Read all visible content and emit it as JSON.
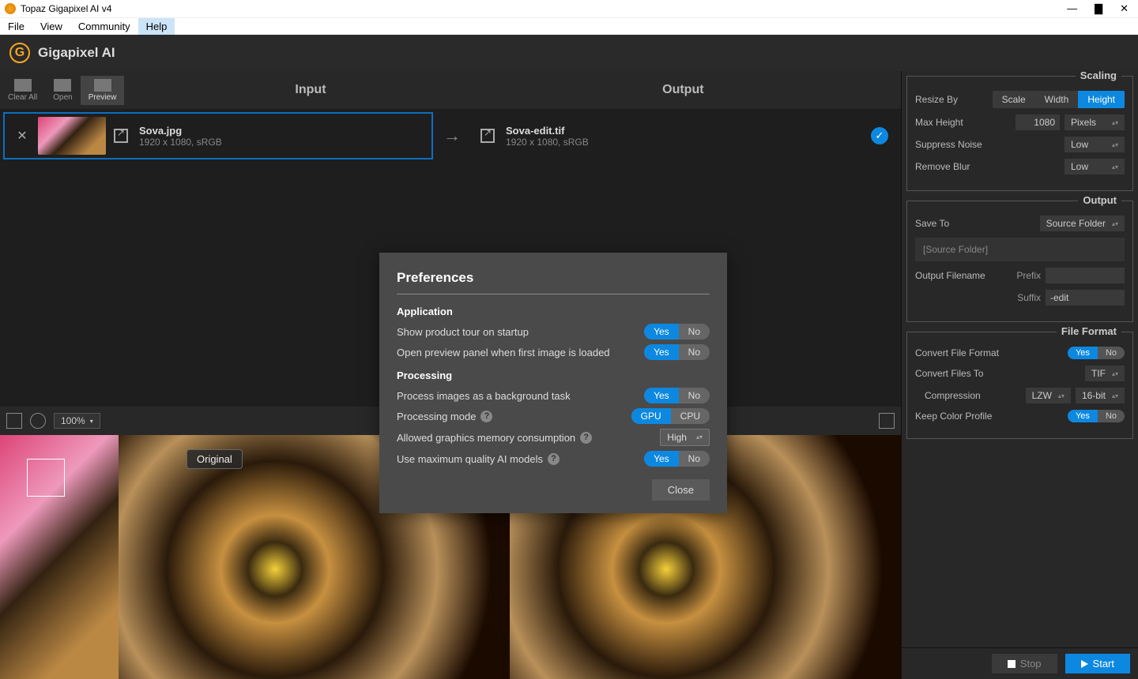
{
  "window": {
    "title": "Topaz Gigapixel AI v4"
  },
  "menu": {
    "file": "File",
    "view": "View",
    "community": "Community",
    "help": "Help"
  },
  "app": {
    "name": "Gigapixel AI",
    "logo_letter": "G"
  },
  "toolbar": {
    "clear_all": "Clear All",
    "open": "Open",
    "preview": "Preview",
    "input_header": "Input",
    "output_header": "Output"
  },
  "input_file": {
    "name": "Sova.jpg",
    "meta": "1920 x 1080, sRGB"
  },
  "output_file": {
    "name": "Sova-edit.tif",
    "meta": "1920 x 1080, sRGB"
  },
  "previewbar": {
    "zoom": "100%",
    "original_badge": "Original"
  },
  "modal": {
    "title": "Preferences",
    "section_app": "Application",
    "row_tour": "Show product tour on startup",
    "row_openprev": "Open preview panel when first image is loaded",
    "section_proc": "Processing",
    "row_bg": "Process images as a background task",
    "row_mode": "Processing mode",
    "row_mem": "Allowed graphics memory consumption",
    "row_maxq": "Use maximum quality AI models",
    "yes": "Yes",
    "no": "No",
    "gpu": "GPU",
    "cpu": "CPU",
    "mem_val": "High",
    "close": "Close"
  },
  "scaling": {
    "title": "Scaling",
    "resize_by": "Resize By",
    "scale": "Scale",
    "width": "Width",
    "height": "Height",
    "max_height": "Max Height",
    "max_height_val": "1080",
    "unit": "Pixels",
    "suppress": "Suppress Noise",
    "suppress_val": "Low",
    "blur": "Remove Blur",
    "blur_val": "Low"
  },
  "output": {
    "title": "Output",
    "save_to": "Save To",
    "save_to_val": "Source Folder",
    "path": "[Source Folder]",
    "filename": "Output Filename",
    "prefix": "Prefix",
    "prefix_val": "",
    "suffix": "Suffix",
    "suffix_val": "-edit"
  },
  "fileformat": {
    "title": "File Format",
    "convert": "Convert File Format",
    "convert_to": "Convert Files To",
    "convert_to_val": "TIF",
    "compression": "Compression",
    "compression_val": "LZW",
    "depth": "16-bit",
    "keep_profile": "Keep Color Profile",
    "yes": "Yes",
    "no": "No"
  },
  "bottom": {
    "stop": "Stop",
    "start": "Start"
  }
}
